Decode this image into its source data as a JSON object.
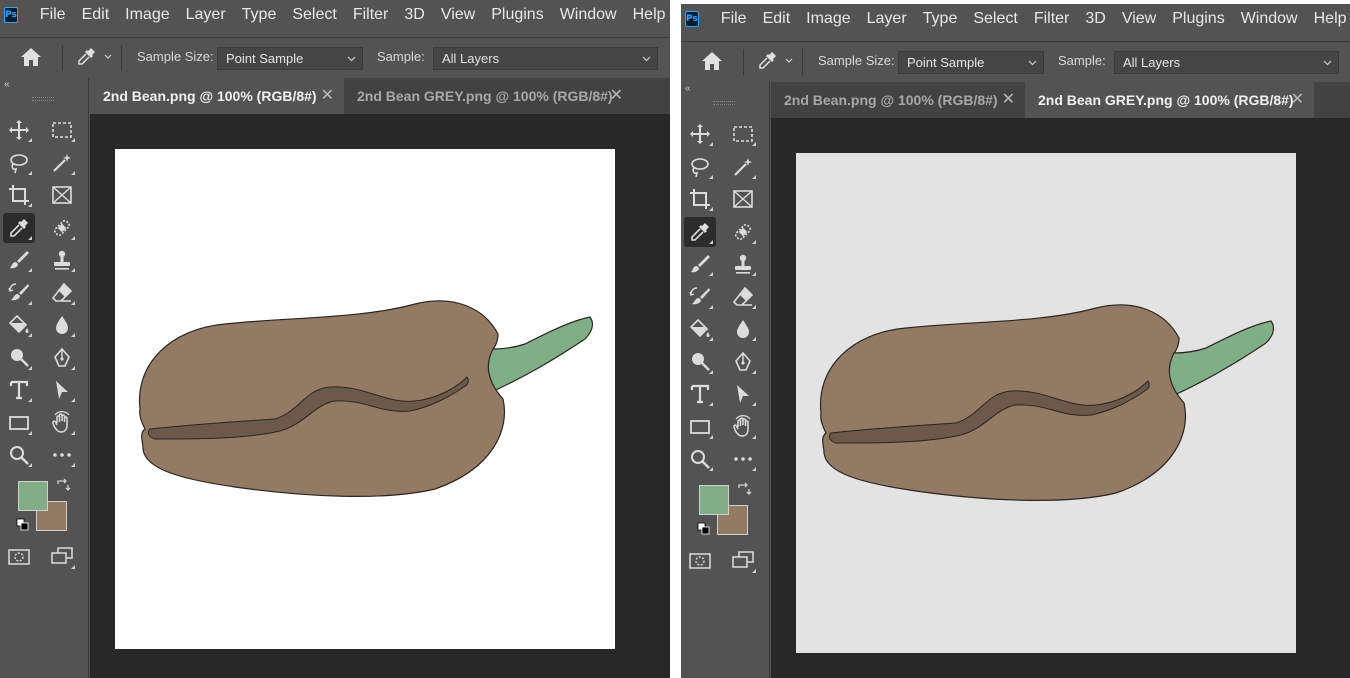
{
  "app": {
    "logo_text": "Ps",
    "menu": [
      "File",
      "Edit",
      "Image",
      "Layer",
      "Type",
      "Select",
      "Filter",
      "3D",
      "View",
      "Plugins",
      "Window",
      "Help"
    ]
  },
  "options_bar": {
    "sample_size_label": "Sample Size:",
    "sample_size_value": "Point Sample",
    "sample_label": "Sample:",
    "sample_value": "All Layers"
  },
  "toolbar": {
    "collapse_glyph": "«",
    "tools": [
      "move-icon",
      "marquee-icon",
      "lasso-icon",
      "magic-wand-icon",
      "crop-icon",
      "frame-icon",
      "eyedropper-icon",
      "healing-brush-icon",
      "brush-icon",
      "clone-stamp-icon",
      "history-brush-icon",
      "eraser-icon",
      "paint-bucket-icon",
      "blur-icon",
      "dodge-icon",
      "pen-icon",
      "type-icon",
      "path-selection-icon",
      "rectangle-icon",
      "hand-icon",
      "zoom-icon",
      "more-icon",
      "quick-mask-icon",
      "screen-mode-icon"
    ],
    "active_tool": "eyedropper-icon",
    "foreground_color": "#82ad87",
    "background_color": "#937a65"
  },
  "windows": [
    {
      "tabs": [
        {
          "label": "2nd Bean.png @ 100% (RGB/8#)",
          "active": true
        },
        {
          "label": "2nd Bean GREY.png @ 100% (RGB/8#)",
          "active": false
        }
      ],
      "canvas_color": "#ffffff"
    },
    {
      "tabs": [
        {
          "label": "2nd Bean.png @ 100% (RGB/8#)",
          "active": false
        },
        {
          "label": "2nd Bean GREY.png @ 100% (RGB/8#)",
          "active": true
        }
      ],
      "canvas_color": "#e3e3e3"
    }
  ],
  "tab_close_glyph": "✕",
  "artwork_colors": {
    "bean": "#937a65",
    "crease": "#6b5949",
    "sprout": "#7fae87",
    "outline": "#2a2520"
  }
}
